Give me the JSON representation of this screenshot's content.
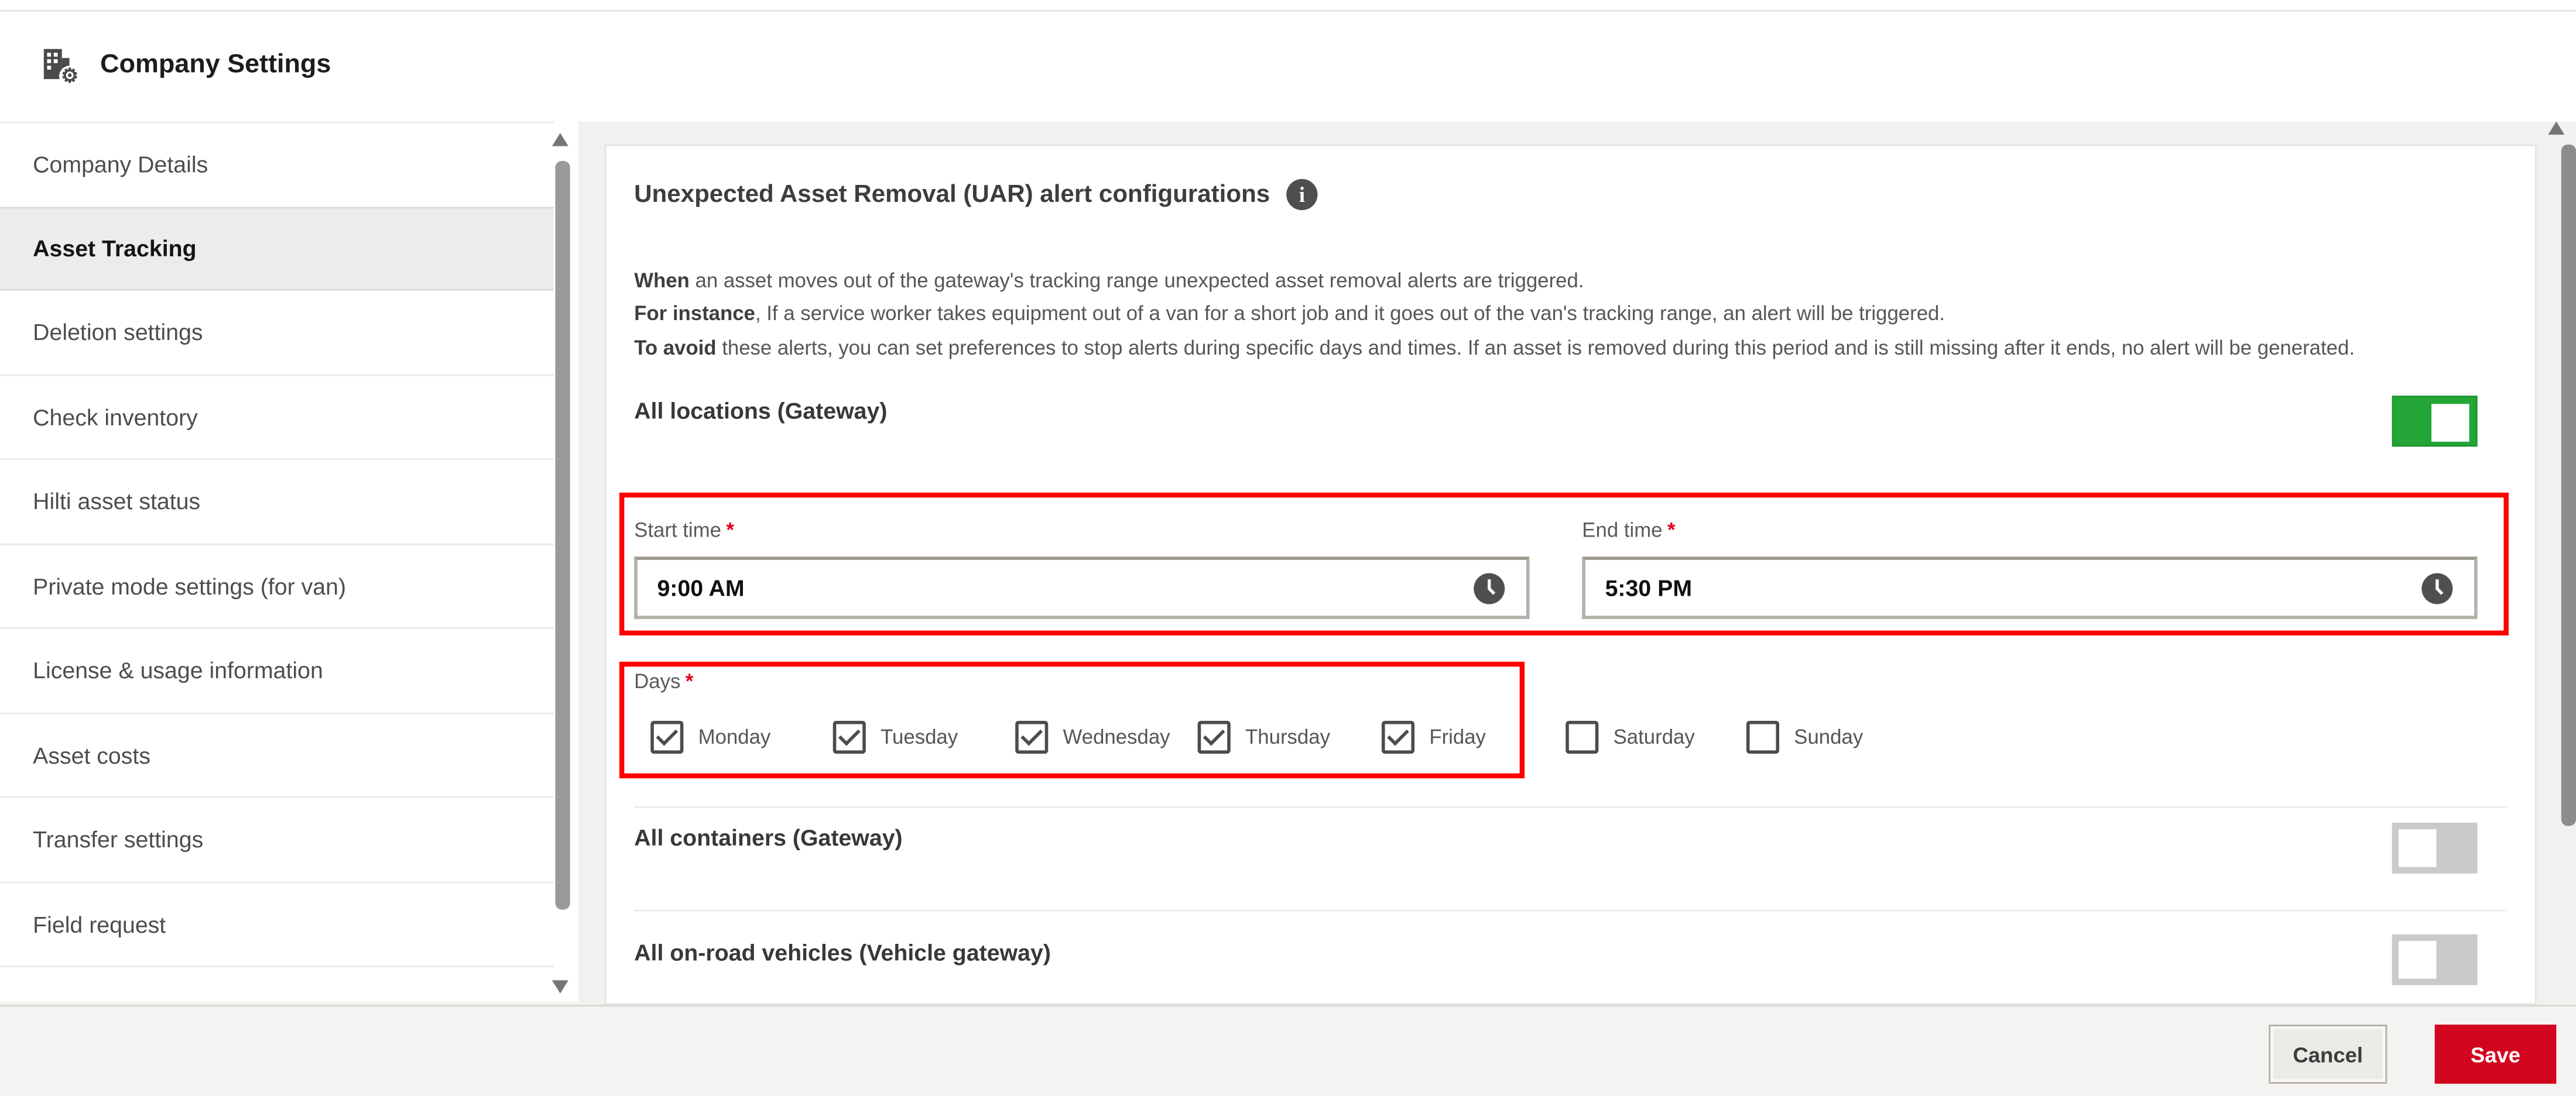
{
  "header": {
    "title": "Company Settings",
    "icon": "building-with-gear"
  },
  "sidebar": {
    "items": [
      {
        "label": "Company Details",
        "selected": false
      },
      {
        "label": "Asset Tracking",
        "selected": true
      },
      {
        "label": "Deletion settings",
        "selected": false
      },
      {
        "label": "Check inventory",
        "selected": false
      },
      {
        "label": "Hilti asset status",
        "selected": false
      },
      {
        "label": "Private mode settings (for van)",
        "selected": false
      },
      {
        "label": "License & usage information",
        "selected": false
      },
      {
        "label": "Asset costs",
        "selected": false
      },
      {
        "label": "Transfer settings",
        "selected": false
      },
      {
        "label": "Field request",
        "selected": false
      }
    ]
  },
  "content": {
    "heading": "Unexpected Asset Removal (UAR) alert configurations",
    "description": [
      {
        "bold": "When",
        "text": " an asset moves out of the gateway's tracking range unexpected asset removal alerts are triggered."
      },
      {
        "bold": "For instance",
        "text": ", If a service worker takes equipment out of a van for a short job and it goes out of the van's tracking range, an alert will be triggered."
      },
      {
        "bold": "To avoid",
        "text": " these alerts, you can set preferences to stop alerts during specific days and times. If an asset is removed during this period and is still missing after it ends, no alert will be generated."
      }
    ],
    "rows": [
      {
        "label": "All locations (Gateway)",
        "state": true
      },
      {
        "label": "All containers (Gateway)",
        "state": false
      },
      {
        "label": "All on-road vehicles (Vehicle gateway)",
        "state": false
      }
    ],
    "time_fields": {
      "start": {
        "label": "Start time",
        "required_marker": "*",
        "value": "9:00 AM"
      },
      "end": {
        "label": "End time",
        "required_marker": "*",
        "value": "5:30 PM"
      }
    },
    "days": {
      "label": "Days",
      "required_marker": "*",
      "options": [
        {
          "label": "Monday",
          "checked": true
        },
        {
          "label": "Tuesday",
          "checked": true
        },
        {
          "label": "Wednesday",
          "checked": true
        },
        {
          "label": "Thursday",
          "checked": true
        },
        {
          "label": "Friday",
          "checked": true
        },
        {
          "label": "Saturday",
          "checked": false
        },
        {
          "label": "Sunday",
          "checked": false
        }
      ]
    }
  },
  "footer": {
    "cancel_label": "Cancel",
    "save_label": "Save"
  },
  "icons": {
    "app": "building-with-gear",
    "info": "info-circle",
    "time_picker": "clock",
    "scroll_up": "triangle-up",
    "scroll_down": "triangle-down"
  },
  "colors": {
    "save_red": "#d2051e",
    "annotation_red": "#fb0100",
    "toggle_on_green": "#23a637",
    "toggle_off_gray": "#cbcac8",
    "selected_item_bg": "#edeceb",
    "page_bg": "#f2f1ef"
  }
}
